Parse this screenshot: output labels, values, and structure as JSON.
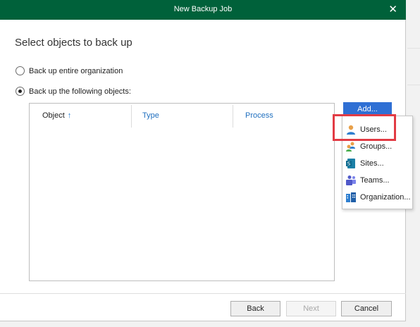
{
  "window": {
    "title": "New Backup Job",
    "close_symbol": "✕"
  },
  "heading": "Select objects to back up",
  "options": [
    {
      "label": "Back up entire organization",
      "checked": false
    },
    {
      "label": "Back up the following objects:",
      "checked": true
    }
  ],
  "table": {
    "columns": [
      "Object",
      "Type",
      "Process"
    ],
    "sort_indicator": "↑",
    "rows": []
  },
  "add_button": "Add...",
  "add_menu": [
    {
      "label": "Users...",
      "icon": "user-icon",
      "highlighted": true
    },
    {
      "label": "Groups...",
      "icon": "group-icon",
      "highlighted": false
    },
    {
      "label": "Sites...",
      "icon": "sharepoint-site-icon",
      "highlighted": false
    },
    {
      "label": "Teams...",
      "icon": "teams-icon",
      "highlighted": false
    },
    {
      "label": "Organization...",
      "icon": "organization-icon",
      "highlighted": false
    }
  ],
  "footer": {
    "back": "Back",
    "next": "Next",
    "cancel": "Cancel",
    "next_enabled": false
  },
  "colors": {
    "titlebar": "#00613a",
    "accent": "#2f6fd4",
    "highlight": "#e23b44"
  }
}
